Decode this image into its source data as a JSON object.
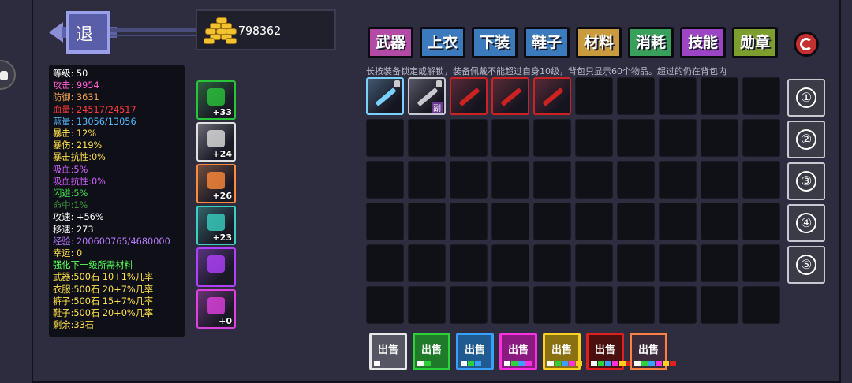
{
  "back_label": "退",
  "gold": "798362",
  "stats": [
    {
      "text": "等级: 50",
      "cls": "white"
    },
    {
      "text": "攻击: 9954",
      "cls": "pink"
    },
    {
      "text": "防御: 3631",
      "cls": "orange"
    },
    {
      "text": "血量: 24517/24517",
      "cls": "red"
    },
    {
      "text": "蓝量: 13056/13056",
      "cls": "blue"
    },
    {
      "text": "暴击: 12%",
      "cls": "yellow"
    },
    {
      "text": "暴伤: 219%",
      "cls": "yellow"
    },
    {
      "text": "暴击抗性:0%",
      "cls": "yellow"
    },
    {
      "text": "吸血:5%",
      "cls": "purple"
    },
    {
      "text": "吸血抗性:0%",
      "cls": "purple"
    },
    {
      "text": "闪避:5%",
      "cls": "green"
    },
    {
      "text": "命中:1%",
      "cls": "dkgreen"
    },
    {
      "text": "攻速: +56%",
      "cls": "white"
    },
    {
      "text": "移速: 273",
      "cls": "white"
    },
    {
      "text": "经验: 200600765/4680000",
      "cls": "lpurple"
    },
    {
      "text": "幸运: 0",
      "cls": "yellow"
    },
    {
      "text": "强化下一级所需材料",
      "cls": "lgreen"
    },
    {
      "text": "武器:500石 10+1%几率",
      "cls": "yellow"
    },
    {
      "text": "衣服:500石 20+7%几率",
      "cls": "yellow"
    },
    {
      "text": "裤子:500石 15+7%几率",
      "cls": "yellow"
    },
    {
      "text": "鞋子:500石 20+0%几率",
      "cls": "yellow"
    },
    {
      "text": "剩余:33石",
      "cls": "yellow"
    }
  ],
  "equipped": [
    {
      "name": "weapon-slot",
      "level": "+33",
      "color": "#29c43a",
      "icon": "crossbow-icon"
    },
    {
      "name": "armor-slot",
      "level": "+24",
      "color": "#e0e0e0",
      "icon": "armor-icon"
    },
    {
      "name": "pants-slot",
      "level": "+26",
      "color": "#ff8a3a",
      "icon": "pants-icon"
    },
    {
      "name": "shoes-slot",
      "level": "+23",
      "color": "#3ad0c0",
      "icon": "boots-icon"
    },
    {
      "name": "skill-slot",
      "level": "",
      "color": "#b040ff",
      "icon": "flower-skill-icon"
    },
    {
      "name": "medal-slot",
      "level": "+0",
      "color": "#e040e0",
      "icon": "shield-medal-icon"
    }
  ],
  "tabs": [
    {
      "label": "武器",
      "bg": "#b24aa6"
    },
    {
      "label": "上衣",
      "bg": "#3b7bbd"
    },
    {
      "label": "下装",
      "bg": "#3b7bbd"
    },
    {
      "label": "鞋子",
      "bg": "#3b7bbd"
    },
    {
      "label": "材料",
      "bg": "#c99a3e"
    },
    {
      "label": "消耗",
      "bg": "#38a05a"
    },
    {
      "label": "技能",
      "bg": "#9b45c4"
    },
    {
      "label": "勋章",
      "bg": "#7d9e2e"
    }
  ],
  "hint": "长按装备锁定或解锁，装备佩戴不能超过自身10级，背包只显示60个物品。超过的仍在背包内",
  "inventory_items": [
    {
      "color": "#7ad0ff",
      "icon": "crossbow-icon",
      "lock": true,
      "badge": ""
    },
    {
      "color": "#c8c8d0",
      "icon": "sword-icon",
      "lock": true,
      "badge": "副"
    },
    {
      "color": "#cc2222",
      "icon": "green-blade-icon",
      "lock": false,
      "badge": ""
    },
    {
      "color": "#cc2222",
      "icon": "bow-icon",
      "lock": false,
      "badge": ""
    },
    {
      "color": "#cc2222",
      "icon": "rifle-icon",
      "lock": false,
      "badge": ""
    }
  ],
  "pages": [
    "①",
    "②",
    "③",
    "④",
    "⑤"
  ],
  "sell_buttons": [
    {
      "label": "出售",
      "border": "#e8e8e8",
      "bg": "#555563",
      "swatches": [
        "#ffffff"
      ]
    },
    {
      "label": "出售",
      "border": "#2cd23a",
      "bg": "#1f7a2a",
      "swatches": [
        "#ffffff",
        "#2cd23a"
      ]
    },
    {
      "label": "出售",
      "border": "#3aa0ff",
      "bg": "#1f5a90",
      "swatches": [
        "#ffffff",
        "#2cd23a",
        "#3aa0ff"
      ]
    },
    {
      "label": "出售",
      "border": "#ff30e0",
      "bg": "#8a1a80",
      "swatches": [
        "#ffffff",
        "#2cd23a",
        "#3aa0ff",
        "#ff30e0"
      ]
    },
    {
      "label": "出售",
      "border": "#ffd020",
      "bg": "#8a7010",
      "swatches": [
        "#ffffff",
        "#2cd23a",
        "#3aa0ff",
        "#ff30e0",
        "#ffd020"
      ]
    },
    {
      "label": "出售",
      "border": "#e02020",
      "bg": "#4a1010",
      "swatches": [
        "#ffffff",
        "#2cd23a",
        "#3aa0ff",
        "#ff30e0",
        "#ffd020",
        "#e02020"
      ]
    },
    {
      "label": "出售",
      "border": "#ff8040",
      "bg": "#3a2a3a",
      "swatches": [
        "#ffffff",
        "#2cd23a",
        "#3aa0ff",
        "#ff30e0",
        "#ffd020",
        "#e02020"
      ]
    }
  ]
}
